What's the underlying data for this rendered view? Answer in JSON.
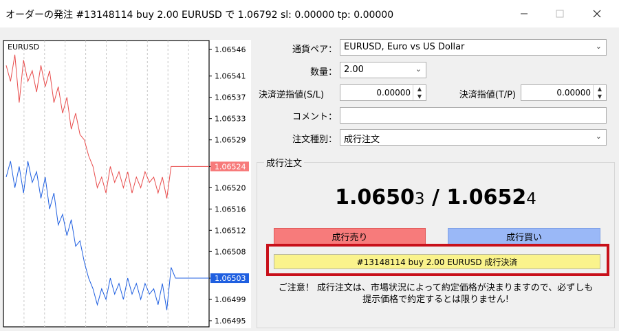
{
  "window": {
    "title": "オーダーの発注 #13148114 buy 2.00 EURUSD で 1.06792 sl: 0.00000 tp: 0.00000",
    "minimize_icon": "minimize-icon",
    "maximize_icon": "maximize-icon",
    "close_icon": "close-icon"
  },
  "chart_data": {
    "type": "line",
    "title": "EURUSD",
    "y_ticks": [
      "1.06546",
      "1.06541",
      "1.06537",
      "1.06533",
      "1.06529",
      "1.06524",
      "1.06520",
      "1.06516",
      "1.06512",
      "1.06508",
      "1.06503",
      "1.06499",
      "1.06495"
    ],
    "ylim": [
      1.06495,
      1.06546
    ],
    "series": [
      {
        "color": "#e84c4c",
        "values": [
          1.06543,
          1.0654,
          1.06545,
          1.06536,
          1.06544,
          1.0654,
          1.06542,
          1.06538,
          1.06543,
          1.06539,
          1.06542,
          1.06536,
          1.06539,
          1.06534,
          1.06537,
          1.06531,
          1.06534,
          1.0653,
          1.06529,
          1.06526,
          1.06524,
          1.0652,
          1.06522,
          1.06519,
          1.06524,
          1.06521,
          1.06523,
          1.0652,
          1.06523,
          1.06519,
          1.06522,
          1.0652,
          1.06523,
          1.06521,
          1.06522,
          1.06519,
          1.06522,
          1.06518,
          1.06524,
          1.06524,
          1.06524,
          1.06524,
          1.06524
        ]
      },
      {
        "color": "#1f5fe0",
        "values": [
          1.06522,
          1.06525,
          1.0652,
          1.06524,
          1.06519,
          1.06525,
          1.06521,
          1.06523,
          1.06518,
          1.06522,
          1.06516,
          1.06519,
          1.06513,
          1.06515,
          1.06511,
          1.06514,
          1.06509,
          1.0651,
          1.06506,
          1.06503,
          1.06501,
          1.06498,
          1.06501,
          1.06499,
          1.06503,
          1.065,
          1.06502,
          1.06499,
          1.06503,
          1.065,
          1.06502,
          1.06499,
          1.06502,
          1.065,
          1.06501,
          1.06498,
          1.06502,
          1.06497,
          1.06505,
          1.06503,
          1.06503,
          1.06503,
          1.06503
        ]
      }
    ],
    "bid_label": {
      "value": "1.06524",
      "color": "#f77b7b"
    },
    "ask_label": {
      "value": "1.06503",
      "color": "#1f5fe0"
    }
  },
  "form": {
    "symbol_label": "通貨ペア：",
    "symbol_value": "EURUSD, Euro vs US Dollar",
    "volume_label": "数量：",
    "volume_value": "2.00",
    "sl_label": "決済逆指値(S/L)",
    "sl_value": "0.00000",
    "tp_label": "決済指値(T/P)",
    "tp_value": "0.00000",
    "comment_label": "コメント：",
    "comment_value": "",
    "type_label": "注文種別：",
    "type_value": "成行注文"
  },
  "market": {
    "group_title": "成行注文",
    "bid_main": "1.0650",
    "bid_tail": "3",
    "separator": " / ",
    "ask_main": "1.0652",
    "ask_tail": "4",
    "sell_label": "成行売り",
    "buy_label": "成行買い",
    "close_label": "#13148114 buy 2.00 EURUSD 成行決済",
    "warning_line1": "ご注意！ 成行注文は、市場状況によって約定価格が決まりますので、必ずしも",
    "warning_line2": "提示価格で約定するとは限りません!"
  },
  "colors": {
    "sell": "#f77b7b",
    "buy": "#9ab8f7",
    "close": "#faf38c",
    "highlight": "#c8101a"
  }
}
